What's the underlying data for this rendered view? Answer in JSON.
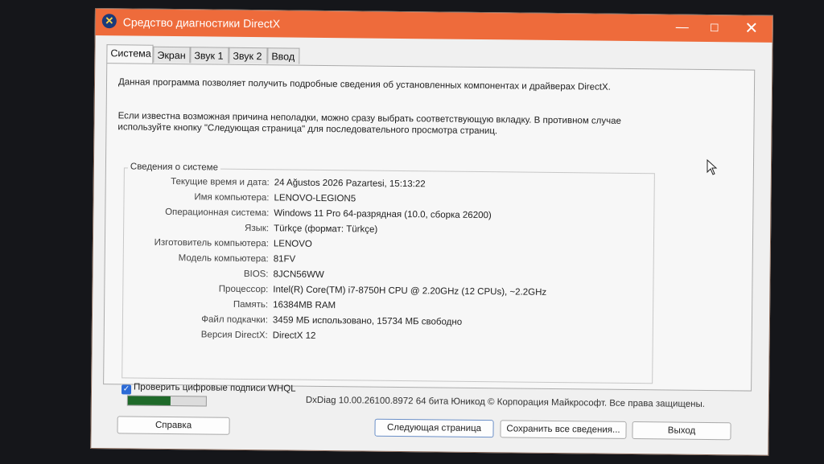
{
  "window": {
    "title": "Средство диагностики DirectX",
    "controls": {
      "minimize": "—",
      "maximize": "☐",
      "close": "✕"
    }
  },
  "tabs": [
    "Система",
    "Экран",
    "Звук 1",
    "Звук 2",
    "Ввод"
  ],
  "intro": {
    "line1": "Данная программа позволяет получить подробные сведения об установленных компонентах и драйверах DirectX.",
    "line2": "Если известна возможная причина неполадки, можно сразу выбрать соответствующую вкладку. В противном случае используйте кнопку \"Следующая страница\" для последовательного просмотра страниц."
  },
  "system_info": {
    "group_title": "Сведения о системе",
    "rows": [
      {
        "label": "Текущие время и дата:",
        "value": "24 Ağustos 2026 Pazartesi, 15:13:22"
      },
      {
        "label": "Имя компьютера:",
        "value": "LENOVO-LEGION5"
      },
      {
        "label": "Операционная система:",
        "value": "Windows 11 Pro 64-разрядная (10.0, сборка 26200)"
      },
      {
        "label": "Язык:",
        "value": "Türkçe (формат: Türkçe)"
      },
      {
        "label": "Изготовитель компьютера:",
        "value": "LENOVO"
      },
      {
        "label": "Модель компьютера:",
        "value": "81FV"
      },
      {
        "label": "BIOS:",
        "value": "8JCN56WW"
      },
      {
        "label": "Процессор:",
        "value": "Intel(R) Core(TM) i7-8750H CPU @ 2.20GHz (12 CPUs), ~2.2GHz"
      },
      {
        "label": "Память:",
        "value": "16384MB RAM"
      },
      {
        "label": "Файл подкачки:",
        "value": "3459 МБ использовано, 15734 МБ свободно"
      },
      {
        "label": "Версия DirectX:",
        "value": "DirectX 12"
      }
    ]
  },
  "whql": {
    "label": "Проверить цифровые подписи WHQL",
    "checked": true
  },
  "progress": {
    "fraction": 0.55,
    "color": "#1f6a2a"
  },
  "footer": {
    "copyright": "DxDiag 10.00.26100.8972 64 бита Юникод © Корпорация Майкрософт. Все права защищены."
  },
  "buttons": {
    "help": "Справка",
    "next": "Следующая страница",
    "save": "Сохранить все сведения...",
    "exit": "Выход"
  },
  "colors": {
    "titlebar": "#ee6b3b",
    "checkbox": "#2d6bd6"
  }
}
